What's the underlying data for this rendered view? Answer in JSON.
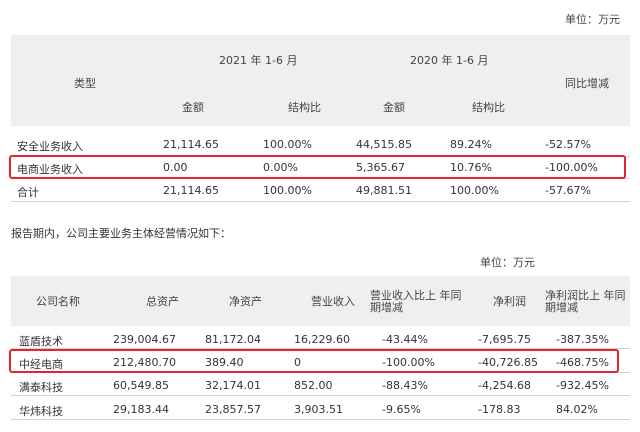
{
  "table1": {
    "unit": "单位：万元",
    "header": {
      "type": "类型",
      "period_2021": "2021 年 1-6 月",
      "period_2020": "2020 年 1-6 月",
      "change": "同比增减",
      "amount": "金额",
      "ratio": "结构比"
    },
    "rows": [
      {
        "type": "安全业务收入",
        "a2021": "21,114.65",
        "r2021": "100.00%",
        "a2020": "44,515.85",
        "r2020": "89.24%",
        "change": "-52.57%"
      },
      {
        "type": "电商业务收入",
        "a2021": "0.00",
        "r2021": "0.00%",
        "a2020": "5,365.67",
        "r2020": "10.76%",
        "change": "-100.00%"
      },
      {
        "type": "合计",
        "a2021": "21,114.65",
        "r2021": "100.00%",
        "a2020": "49,881.51",
        "r2020": "100.00%",
        "change": "-57.67%"
      }
    ]
  },
  "intro_text": "报告期内，公司主要业务主体经营情况如下：",
  "table2": {
    "unit": "单位：万元",
    "header": {
      "company": "公司名称",
      "total_assets": "总资产",
      "net_assets": "净资产",
      "revenue": "营业收入",
      "revenue_change": "营业收入比上 年同期增减",
      "net_profit": "净利润",
      "profit_change": "净利润比上 年同期增减"
    },
    "rows": [
      {
        "company": "蓝盾技术",
        "total_assets": "239,004.67",
        "net_assets": "81,172.04",
        "revenue": "16,229.60",
        "revenue_change": "-43.44%",
        "net_profit": "-7,695.75",
        "profit_change": "-387.35%"
      },
      {
        "company": "中经电商",
        "total_assets": "212,480.70",
        "net_assets": "389.40",
        "revenue": "0",
        "revenue_change": "-100.00%",
        "net_profit": "-40,726.85",
        "profit_change": "-468.75%"
      },
      {
        "company": "满泰科技",
        "total_assets": "60,549.85",
        "net_assets": "32,174.01",
        "revenue": "852.00",
        "revenue_change": "-88.43%",
        "net_profit": "-4,254.68",
        "profit_change": "-932.45%"
      },
      {
        "company": "华炜科技",
        "total_assets": "29,183.44",
        "net_assets": "23,857.57",
        "revenue": "3,903.51",
        "revenue_change": "-9.65%",
        "net_profit": "-178.83",
        "profit_change": "84.02%"
      }
    ]
  },
  "colors": {
    "highlight_border": "#e8232b",
    "header_band": "#efefef",
    "rule": "#d2d2d2"
  }
}
